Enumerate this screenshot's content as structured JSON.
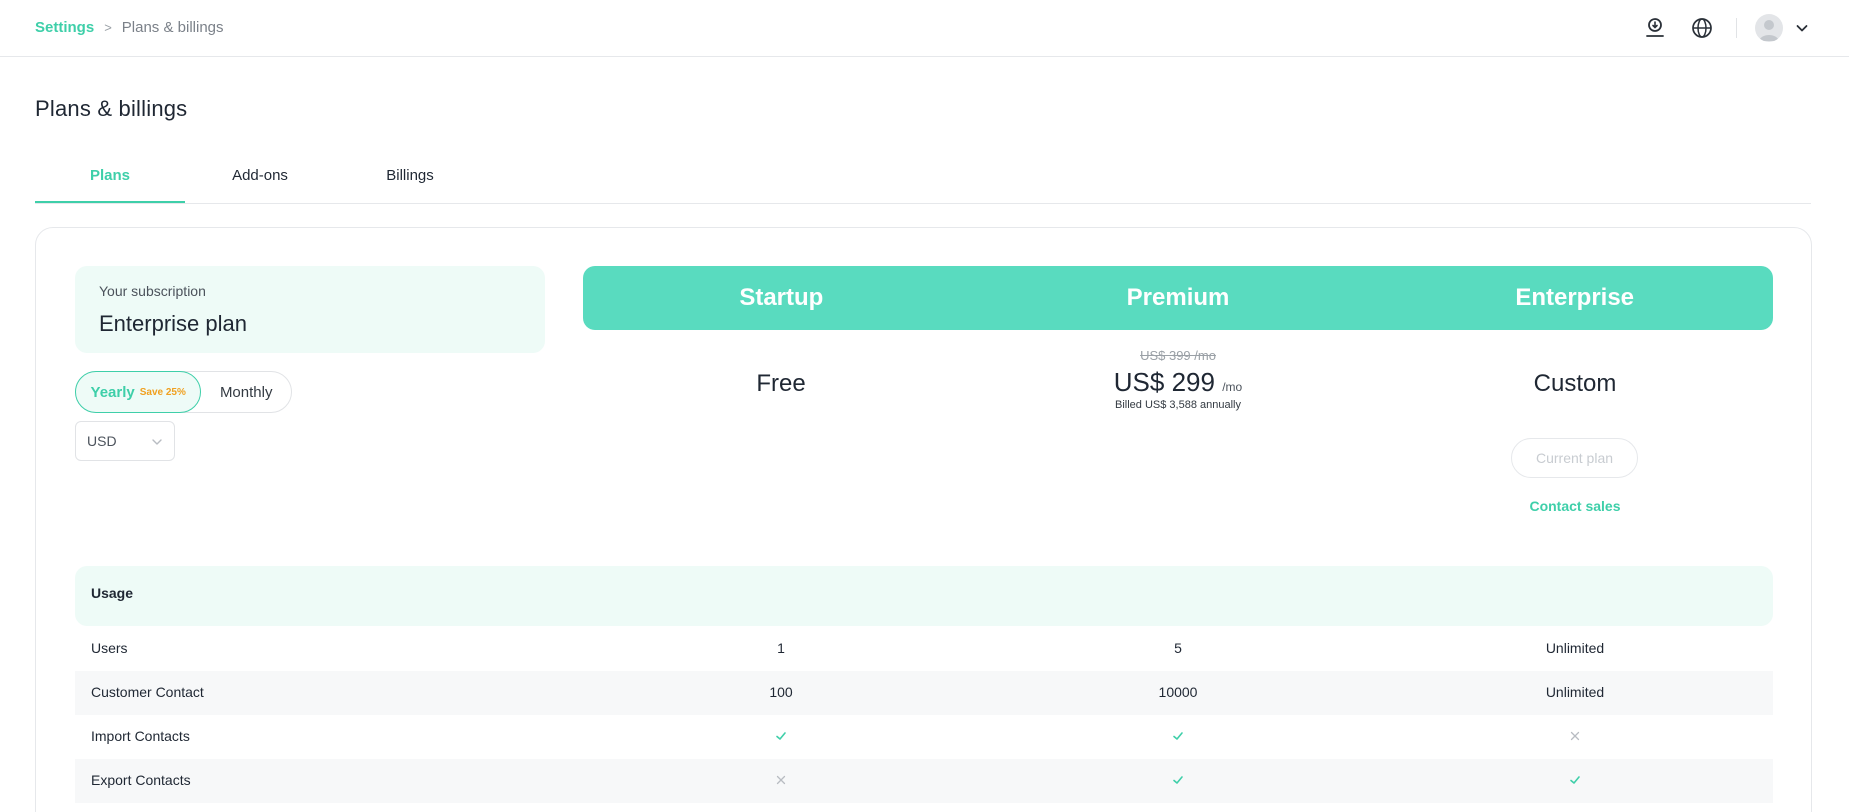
{
  "breadcrumb": {
    "parent": "Settings",
    "separator": ">",
    "current": "Plans & billings"
  },
  "topbar": {
    "icons": [
      "user-download-icon",
      "globe-icon",
      "avatar",
      "chevron-down-icon"
    ]
  },
  "page": {
    "title": "Plans & billings"
  },
  "tabs": [
    {
      "label": "Plans",
      "active": true
    },
    {
      "label": "Add-ons",
      "active": false
    },
    {
      "label": "Billings",
      "active": false
    }
  ],
  "subscription": {
    "label": "Your subscription",
    "plan": "Enterprise plan"
  },
  "billing_toggle": {
    "yearly": "Yearly",
    "save": "Save 25%",
    "monthly": "Monthly",
    "selected": "Yearly"
  },
  "currency": {
    "selected": "USD"
  },
  "plans": [
    {
      "name": "Startup",
      "price": "Free"
    },
    {
      "name": "Premium",
      "old_price": "US$ 399 /mo",
      "price": "US$ 299",
      "unit": "/mo",
      "note": "Billed US$ 3,588 annually"
    },
    {
      "name": "Enterprise",
      "price": "Custom",
      "current_label": "Current plan",
      "contact_label": "Contact sales"
    }
  ],
  "usage": {
    "title": "Usage",
    "rows": [
      {
        "feature": "Users",
        "values": [
          "1",
          "5",
          "Unlimited"
        ]
      },
      {
        "feature": "Customer Contact",
        "values": [
          "100",
          "10000",
          "Unlimited"
        ]
      },
      {
        "feature": "Import Contacts",
        "values": [
          "check",
          "check",
          "cross"
        ]
      },
      {
        "feature": "Export Contacts",
        "values": [
          "cross",
          "check",
          "check"
        ]
      }
    ]
  },
  "colors": {
    "accent": "#3ecfa9",
    "header_fill": "#59dbbf",
    "soft_fill": "#eefbf7",
    "badge": "#f0a020"
  }
}
